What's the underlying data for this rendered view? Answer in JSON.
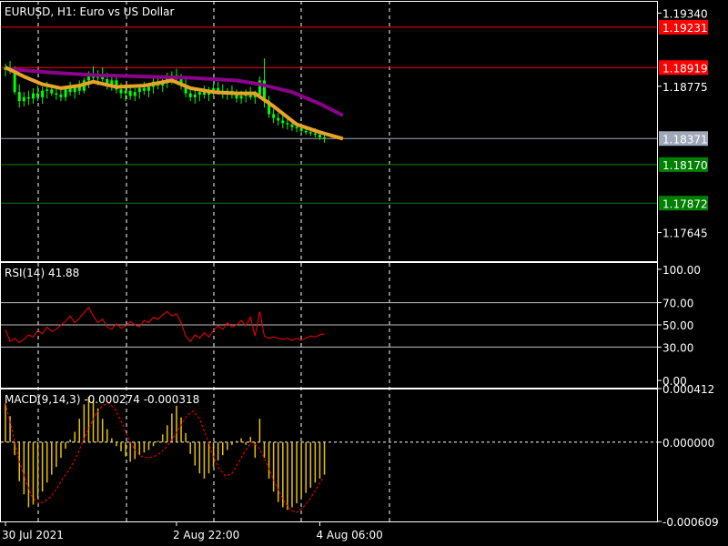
{
  "symbol_title": "EURUSD, H1:  Euro vs US Dollar",
  "colors": {
    "background": "#000000",
    "frame": "#ffffff",
    "grid": "#ffffff",
    "candles": "#00ff00",
    "ma_slow": "#8b008b",
    "ma_fast": "#e8a32a",
    "rsi": "#ff0000",
    "macd_hist": "#e6c200",
    "macd_signal": "#ff0000",
    "level_red": "#ff0000",
    "level_green": "#008000",
    "level_grey": "#a0a8b8"
  },
  "chart_data": [
    {
      "type": "candlestick",
      "title": "EURUSD, H1:  Euro vs US Dollar",
      "ylim": [
        1.17424,
        1.19434
      ],
      "y_ticks": [
        "1.19340",
        "1.18775",
        "1.17645"
      ],
      "y_tick_values": [
        1.1934,
        1.18775,
        1.17645
      ],
      "x_ticks": [
        "30 Jul 2021",
        "2 Aug 22:00",
        "4 Aug 06:00"
      ],
      "x_tick_values": [
        0,
        37,
        68
      ],
      "x_range": [
        0,
        180
      ],
      "price_levels": [
        {
          "label": "1.19231",
          "value": 1.19231,
          "color": "#ff0000"
        },
        {
          "label": "1.18919",
          "value": 1.18919,
          "color": "#ff0000"
        },
        {
          "label": "1.18371",
          "value": 1.18371,
          "color": "#a0a8b8"
        },
        {
          "label": "1.18170",
          "value": 1.1817,
          "color": "#008000"
        },
        {
          "label": "1.17872",
          "value": 1.17872,
          "color": "#008000"
        }
      ],
      "ohlc": [
        [
          1.189,
          1.1895,
          1.1885,
          1.1892
        ],
        [
          1.1892,
          1.1897,
          1.1887,
          1.1889
        ],
        [
          1.1889,
          1.1893,
          1.1871,
          1.1873
        ],
        [
          1.1873,
          1.1879,
          1.1861,
          1.1866
        ],
        [
          1.1866,
          1.1873,
          1.1862,
          1.1869
        ],
        [
          1.1869,
          1.1874,
          1.1863,
          1.1868
        ],
        [
          1.1868,
          1.1876,
          1.1864,
          1.1872
        ],
        [
          1.1872,
          1.1878,
          1.1866,
          1.1869
        ],
        [
          1.1869,
          1.1877,
          1.1864,
          1.1874
        ],
        [
          1.1874,
          1.1881,
          1.1868,
          1.1875
        ],
        [
          1.1875,
          1.1879,
          1.187,
          1.1872
        ],
        [
          1.1872,
          1.1876,
          1.1867,
          1.1871
        ],
        [
          1.1871,
          1.1875,
          1.1866,
          1.1869
        ],
        [
          1.1869,
          1.1878,
          1.1866,
          1.1876
        ],
        [
          1.1876,
          1.1881,
          1.187,
          1.1873
        ],
        [
          1.1873,
          1.1879,
          1.1868,
          1.1877
        ],
        [
          1.1877,
          1.1882,
          1.1871,
          1.1874
        ],
        [
          1.1874,
          1.1884,
          1.1872,
          1.1882
        ],
        [
          1.1882,
          1.1889,
          1.1876,
          1.1886
        ],
        [
          1.1886,
          1.1893,
          1.188,
          1.1884
        ],
        [
          1.1884,
          1.189,
          1.1878,
          1.1887
        ],
        [
          1.1887,
          1.1892,
          1.1881,
          1.1883
        ],
        [
          1.1883,
          1.1888,
          1.1875,
          1.1879
        ],
        [
          1.1879,
          1.1886,
          1.1874,
          1.1882
        ],
        [
          1.1882,
          1.1886,
          1.1872,
          1.1875
        ],
        [
          1.1875,
          1.188,
          1.1868,
          1.1872
        ],
        [
          1.1872,
          1.1878,
          1.1866,
          1.1874
        ],
        [
          1.1874,
          1.1879,
          1.1867,
          1.187
        ],
        [
          1.187,
          1.1876,
          1.1866,
          1.1873
        ],
        [
          1.1873,
          1.1879,
          1.1868,
          1.1876
        ],
        [
          1.1876,
          1.1881,
          1.1871,
          1.1874
        ],
        [
          1.1874,
          1.1879,
          1.1869,
          1.1877
        ],
        [
          1.1877,
          1.1884,
          1.1872,
          1.1881
        ],
        [
          1.1881,
          1.1886,
          1.1875,
          1.1878
        ],
        [
          1.1878,
          1.1883,
          1.1873,
          1.1881
        ],
        [
          1.1881,
          1.1888,
          1.1876,
          1.1884
        ],
        [
          1.1884,
          1.1889,
          1.1879,
          1.1886
        ],
        [
          1.1886,
          1.1891,
          1.188,
          1.1883
        ],
        [
          1.1883,
          1.1887,
          1.1875,
          1.1878
        ],
        [
          1.1878,
          1.1883,
          1.1869,
          1.1872
        ],
        [
          1.1872,
          1.1877,
          1.1866,
          1.1869
        ],
        [
          1.1869,
          1.1875,
          1.1864,
          1.1871
        ],
        [
          1.1871,
          1.1876,
          1.1866,
          1.1873
        ],
        [
          1.1873,
          1.1878,
          1.1868,
          1.1871
        ],
        [
          1.1871,
          1.1877,
          1.1866,
          1.1874
        ],
        [
          1.1874,
          1.1879,
          1.1869,
          1.1876
        ],
        [
          1.1876,
          1.1881,
          1.1871,
          1.1874
        ],
        [
          1.1874,
          1.1879,
          1.1868,
          1.1872
        ],
        [
          1.1872,
          1.1876,
          1.1867,
          1.1874
        ],
        [
          1.1874,
          1.1878,
          1.1868,
          1.1871
        ],
        [
          1.1871,
          1.1875,
          1.1865,
          1.1868
        ],
        [
          1.1868,
          1.1874,
          1.1864,
          1.187
        ],
        [
          1.187,
          1.1875,
          1.1865,
          1.1872
        ],
        [
          1.1872,
          1.1877,
          1.1867,
          1.1869
        ],
        [
          1.1869,
          1.1874,
          1.1864,
          1.1871
        ],
        [
          1.1871,
          1.1885,
          1.1869,
          1.1882
        ],
        [
          1.1882,
          1.1899,
          1.1861,
          1.1866
        ],
        [
          1.1866,
          1.187,
          1.1853,
          1.1856
        ],
        [
          1.1856,
          1.186,
          1.1849,
          1.1853
        ],
        [
          1.1853,
          1.1857,
          1.1847,
          1.1851
        ],
        [
          1.1851,
          1.1855,
          1.1845,
          1.1849
        ],
        [
          1.1849,
          1.1853,
          1.1844,
          1.1848
        ],
        [
          1.1848,
          1.1851,
          1.1843,
          1.1846
        ],
        [
          1.1846,
          1.185,
          1.1842,
          1.1845
        ],
        [
          1.1845,
          1.1849,
          1.1841,
          1.1843
        ],
        [
          1.1843,
          1.1847,
          1.184,
          1.1842
        ],
        [
          1.1842,
          1.1846,
          1.1839,
          1.1841
        ],
        [
          1.1841,
          1.1845,
          1.1838,
          1.184
        ],
        [
          1.184,
          1.1843,
          1.1836,
          1.1838
        ],
        [
          1.1838,
          1.1841,
          1.1834,
          1.1837
        ]
      ],
      "ma_slow": [
        [
          0,
          1.1891
        ],
        [
          10,
          1.1888
        ],
        [
          20,
          1.1886
        ],
        [
          30,
          1.1885
        ],
        [
          40,
          1.1884
        ],
        [
          50,
          1.1882
        ],
        [
          55,
          1.1879
        ],
        [
          62,
          1.1873
        ],
        [
          68,
          1.1864
        ],
        [
          73,
          1.1855
        ]
      ],
      "ma_fast": [
        [
          0,
          1.1892
        ],
        [
          4,
          1.1885
        ],
        [
          8,
          1.1879
        ],
        [
          12,
          1.1876
        ],
        [
          16,
          1.1878
        ],
        [
          19,
          1.1881
        ],
        [
          24,
          1.1877
        ],
        [
          30,
          1.1878
        ],
        [
          36,
          1.1882
        ],
        [
          40,
          1.1876
        ],
        [
          45,
          1.1873
        ],
        [
          50,
          1.1872
        ],
        [
          54,
          1.1872
        ],
        [
          58,
          1.1862
        ],
        [
          63,
          1.1848
        ],
        [
          68,
          1.1842
        ],
        [
          73,
          1.1837
        ]
      ]
    },
    {
      "type": "line",
      "title": "RSI(14) 41.88",
      "ylim": [
        -6.5,
        106.5
      ],
      "y_ticks": [
        "100.00",
        "70.00",
        "50.00",
        "30.00",
        "0.00"
      ],
      "y_tick_values": [
        100,
        70,
        50,
        30,
        0
      ],
      "levels": [
        70,
        50,
        30
      ],
      "values": [
        46,
        35,
        38,
        34,
        37,
        41,
        39,
        45,
        42,
        48,
        44,
        46,
        50,
        53,
        58,
        52,
        56,
        61,
        66,
        58,
        52,
        55,
        48,
        46,
        51,
        47,
        49,
        53,
        50,
        48,
        54,
        52,
        57,
        55,
        59,
        62,
        58,
        60,
        52,
        40,
        35,
        41,
        38,
        43,
        39,
        45,
        49,
        46,
        52,
        48,
        50,
        54,
        49,
        57,
        40,
        62,
        40,
        38,
        39,
        38,
        37,
        38,
        36,
        38,
        36,
        38,
        40,
        39,
        41,
        42
      ]
    },
    {
      "type": "bar",
      "title": "MACD(9,14,3) -0.000274 -0.000318",
      "ylim": [
        -0.000609,
        0.000412
      ],
      "y_ticks": [
        "0.000412",
        "0.000000",
        "-0.000609"
      ],
      "y_tick_values": [
        0.000412,
        0,
        -0.000609
      ],
      "zero_line": 0,
      "histogram": [
        0.0003,
        0.0002,
        -0.0001,
        -0.0003,
        -0.0004,
        -0.0005,
        -0.00048,
        -0.00043,
        -0.00038,
        -0.00031,
        -0.00025,
        -0.00019,
        -0.00012,
        -5e-05,
        2e-05,
        8e-05,
        0.00018,
        0.00029,
        0.00035,
        0.00032,
        0.00026,
        0.00018,
        0.0001,
        3e-05,
        -3e-05,
        -7e-05,
        -0.00011,
        -0.00015,
        -0.00013,
        -0.0001,
        -8e-05,
        -6e-05,
        -3e-05,
        1e-05,
        6e-05,
        0.00013,
        0.00022,
        0.00028,
        0.00019,
        7e-05,
        -9e-05,
        -0.00018,
        -0.00024,
        -0.00028,
        -0.00024,
        -0.00019,
        -0.00014,
        -0.0001,
        -6e-05,
        -2e-05,
        1e-05,
        3e-05,
        -2e-05,
        4e-05,
        -0.00012,
        0.00018,
        -0.00012,
        -0.00028,
        -0.00038,
        -0.00046,
        -0.0005,
        -0.00052,
        -0.0005,
        -0.00047,
        -0.00043,
        -0.00039,
        -0.00035,
        -0.00031,
        -0.00028,
        -0.00025
      ],
      "signal": [
        0.0003,
        0.0001,
        -0.00012,
        -0.00028,
        -0.00041,
        -0.00047,
        -0.00046,
        -0.00042,
        -0.00035,
        -0.00027,
        -0.0002,
        -0.00011,
        1e-05,
        0.00012,
        0.00022,
        0.00028,
        0.0003,
        0.00025,
        0.00015,
        3e-05,
        -6e-05,
        -0.00011,
        -0.00012,
        -0.00011,
        -8e-05,
        -3e-05,
        4e-05,
        0.00012,
        0.0002,
        0.00024,
        0.00018,
        5e-05,
        -0.0001,
        -0.0002,
        -0.00026,
        -0.00024,
        -0.00016,
        -7e-05,
        0,
        -3e-05,
        -0.00012,
        -0.00024,
        -0.00035,
        -0.00045,
        -0.00052,
        -0.00054,
        -0.0005,
        -0.00044,
        -0.00036,
        -0.00028
      ]
    }
  ]
}
